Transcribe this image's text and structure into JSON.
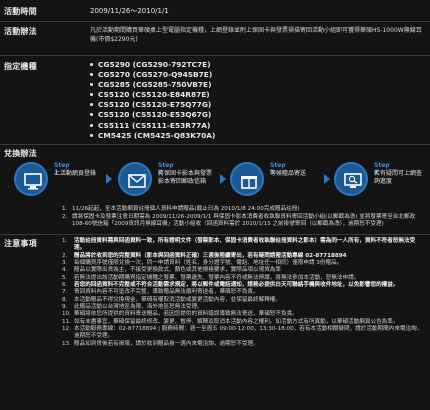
{
  "date": {
    "label": "活動時間",
    "value": "2009/11/26～2010/1/1"
  },
  "method": {
    "label": "活動辦法",
    "text": "凡於活動期間購買華碩桌上型電腦指定機種，上網登錄並附上保固卡與發票掃描寄回活動小組即可獲得華碩HS-1000W無線耳機(市價$2290元)"
  },
  "models": {
    "label": "指定機種",
    "items": [
      "CG5290 (CG5290-792TC7E)",
      "CG5270 (CG5270-Q94SB7E)",
      "CG5285 (CG5285-750VB7E)",
      "CS5120 (CS5120-E84R87E)",
      "CS5120 (CS5120-E75Q77G)",
      "CS5120 (CS5120-E53Q67G)",
      "CS5111 (CS5111-E53R77A)",
      "CM5425 (CM5425-Q83K70A)"
    ]
  },
  "exchange": {
    "label": "兌換辦法",
    "steps": [
      {
        "title": "Step 1",
        "text": "上活動網頁登錄"
      },
      {
        "title": "Step 2",
        "text": "將保固卡影本與發票影本寄回郵政信箱"
      },
      {
        "title": "Step 3",
        "text": "等候贈品寄送"
      },
      {
        "title": "Step 4",
        "text": "若有疑問可上網查詢進度"
      }
    ],
    "rules": [
      {
        "n": "1.",
        "text": "11/26起起，至本活動網頁註冊個人資料申請贈品(截止日為 2010/1/8 24:00完成贈品註冊)"
      },
      {
        "n": "2.",
        "text": "請將保固卡及發票注意日期需為 2009/11/26-2009/1/1 與保固卡影本消費者收執聯資料寄回活動小組(以郵戳為憑) 並將發票寄至台北郵政108-60號信箱「2009資訊月無線耳機」活動小組收（回函資料需於 2010/1/15 之前掛號寄回（以郵戳為憑），逾期恕不受理)"
      }
    ]
  },
  "notes": {
    "label": "注意事項",
    "items": [
      {
        "n": "1.",
        "text": "活動註冊資料需與回函資料一致，所有證明文件（發票影本、保固卡消費者收執聯註冊資料之影本）需為同一人所有，資料不符者恕無法受理。"
      },
      {
        "n": "2.",
        "text": "贈品將於收到您的完整資料（影本與回函資料正確）三週後陸續寄出，若有疑問請撥活動專線 02-87718894"
      },
      {
        "n": "3.",
        "text": "每個購買序號僅限兌換一次，同一申請資料（姓名、身分證字號、電話、地址任一相同）僅限申請 3份贈品。"
      },
      {
        "n": "4.",
        "text": "贈品以實際出貨為主，不接受更換款式、顏色或其他規格要求，實際品項以現貨為準"
      },
      {
        "n": "5.",
        "text": "若無法提出該活動期購買指定機種之發票、發票遺失、發票內容不符或無法辨識，將無法參加本活動，恕無法申請。"
      },
      {
        "n": "6.",
        "text": "若您的回函資料不完整或不符合活動需求規定，將以郵件或電話通知，請務必提供白天可聯絡手機與收件地址，以免影響您的權益。"
      },
      {
        "n": "7.",
        "text": "寄回資料內容不可塗改不完整，導致贈品無法順利寄送者，華碩恕不負責。"
      },
      {
        "n": "8.",
        "text": "本活動贈品不得兌換現金，華碩有權取消活動或變更活動內容，並保留最終解釋權。"
      },
      {
        "n": "9.",
        "text": "此贈品活動以台灣地區為限，海外地區恕無法受理。"
      },
      {
        "n": "10.",
        "text": "華碩將依您所提供的資料寄送贈品，若因您提供的資料錯誤導致無法寄送，華碩恕不負責。"
      },
      {
        "n": "11.",
        "text": "如有未盡事宜，華碩保留最終修改、變更、暫停、解釋及取消本活動內容之權利。如活動方式有所異動，以華碩活動網頁公告為準。"
      },
      {
        "n": "12.",
        "text": "本活動服務專線：02-87718894 | 服務時間：週一至週五 09:00-12:00，13:30-18:00，若有本活動相關疑問，請於活動期間內來電洽詢，逾期恕不受理。"
      },
      {
        "n": "13.",
        "text": "贈品如到貨後若有損壞，請於收到贈品後一週內來電洽詢，逾期恕不受理。"
      }
    ]
  }
}
